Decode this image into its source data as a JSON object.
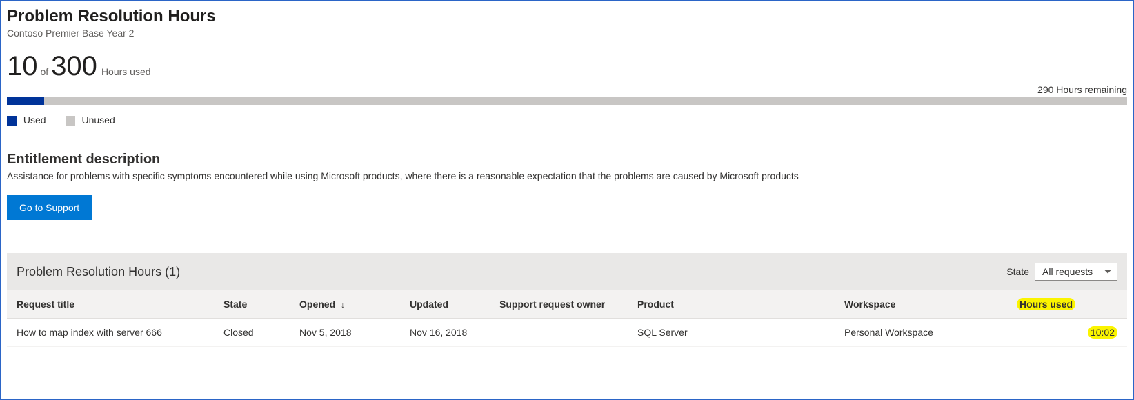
{
  "header": {
    "title": "Problem Resolution Hours",
    "subtitle": "Contoso Premier Base Year 2"
  },
  "usage": {
    "used": "10",
    "of_word": "of",
    "total": "300",
    "unit_label": "Hours used",
    "remaining_label": "290 Hours remaining",
    "percent_used": 3.33
  },
  "legend": {
    "used_label": "Used",
    "unused_label": "Unused"
  },
  "entitlement": {
    "heading": "Entitlement description",
    "text": "Assistance for problems with specific symptoms encountered while using Microsoft products, where there is a reasonable expectation that the problems are caused by Microsoft products",
    "button_label": "Go to Support"
  },
  "grid": {
    "title": "Problem Resolution Hours (1)",
    "filter_label": "State",
    "filter_value": "All requests",
    "columns": {
      "title": "Request title",
      "state": "State",
      "opened": "Opened",
      "updated": "Updated",
      "owner": "Support request owner",
      "product": "Product",
      "workspace": "Workspace",
      "hours": "Hours used"
    },
    "sort_icon": "↓",
    "rows": [
      {
        "title": "How to map index with server 666",
        "state": "Closed",
        "opened": "Nov 5, 2018",
        "updated": "Nov 16, 2018",
        "owner": "",
        "product": "SQL Server",
        "workspace": "Personal Workspace",
        "hours": "10:02"
      }
    ]
  },
  "colors": {
    "used": "#003399",
    "unused": "#c8c6c4",
    "primary_button": "#0078d4",
    "highlight": "#fbf400"
  },
  "chart_data": {
    "type": "bar",
    "title": "Problem Resolution Hours",
    "categories": [
      "Used",
      "Unused"
    ],
    "values": [
      10,
      290
    ],
    "total": 300,
    "xlabel": "",
    "ylabel": "Hours",
    "ylim": [
      0,
      300
    ]
  }
}
